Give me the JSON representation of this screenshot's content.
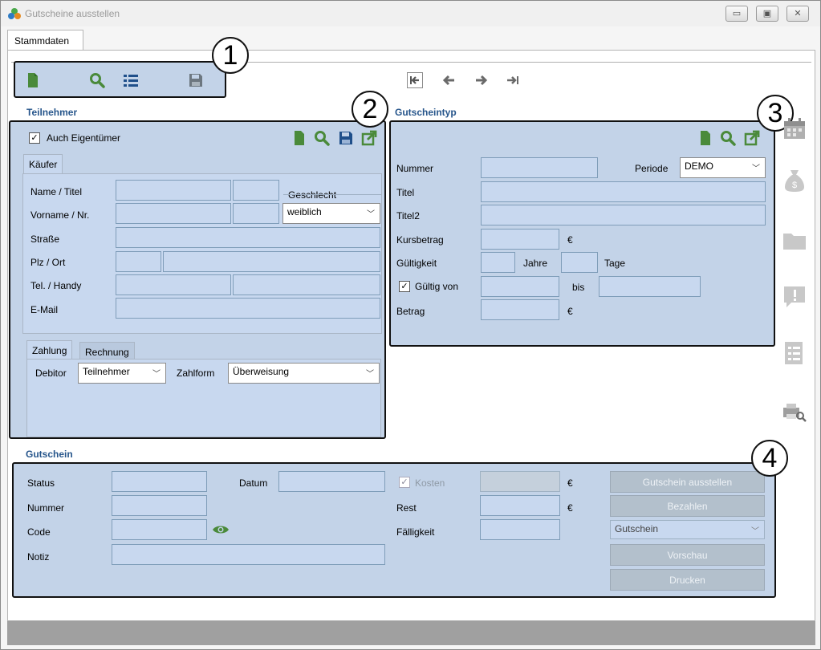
{
  "window": {
    "title": "Gutscheine ausstellen",
    "controls": {
      "minimize": "▭",
      "maximize": "▣",
      "close": "✕"
    }
  },
  "tabs": {
    "stammdaten": "Stammdaten"
  },
  "toolbar": {
    "icons": [
      "new-document-icon",
      "search-icon",
      "list-icon",
      "save-icon"
    ],
    "nav_icons": [
      "first-record-icon",
      "previous-record-icon",
      "next-record-icon",
      "last-record-icon"
    ]
  },
  "callouts": [
    "1",
    "2",
    "3",
    "4"
  ],
  "teilnehmer": {
    "title": "Teilnehmer",
    "auch_eigentuemer": {
      "label": "Auch Eigentümer",
      "checked": true
    },
    "kaeufer_tab": "Käufer",
    "labels": {
      "name_titel": "Name / Titel",
      "vorname_nr": "Vorname / Nr.",
      "strasse": "Straße",
      "plz_ort": "Plz / Ort",
      "tel_handy": "Tel. / Handy",
      "email": "E-Mail",
      "geschlecht": "Geschlecht"
    },
    "geschlecht_value": "weiblich",
    "payment_tabs": {
      "zahlung": "Zahlung",
      "rechnung": "Rechnung"
    },
    "debitor": {
      "label": "Debitor",
      "value": "Teilnehmer"
    },
    "zahlform": {
      "label": "Zahlform",
      "value": "Überweisung"
    }
  },
  "gutscheintyp": {
    "title": "Gutscheintyp",
    "labels": {
      "nummer": "Nummer",
      "periode": "Periode",
      "titel": "Titel",
      "titel2": "Titel2",
      "kursbetrag": "Kursbetrag",
      "gueltigkeit": "Gültigkeit",
      "jahre": "Jahre",
      "tage": "Tage",
      "gueltig_von": "Gültig von",
      "bis": "bis",
      "betrag": "Betrag",
      "currency": "€"
    },
    "periode_value": "DEMO",
    "gueltig_von_checked": true
  },
  "gutschein": {
    "title": "Gutschein",
    "labels": {
      "status": "Status",
      "datum": "Datum",
      "nummer": "Nummer",
      "code": "Code",
      "notiz": "Notiz",
      "kosten": "Kosten",
      "rest": "Rest",
      "faelligkeit": "Fälligkeit",
      "currency": "€"
    },
    "kosten_checked": true,
    "buttons": {
      "ausstellen": "Gutschein ausstellen",
      "bezahlen": "Bezahlen",
      "vorschau": "Vorschau",
      "drucken": "Drucken"
    },
    "type_select": "Gutschein"
  },
  "side_icons": [
    "calendar-icon",
    "money-bag-icon",
    "folder-icon",
    "comment-alert-icon",
    "checklist-icon",
    "print-preview-icon"
  ]
}
